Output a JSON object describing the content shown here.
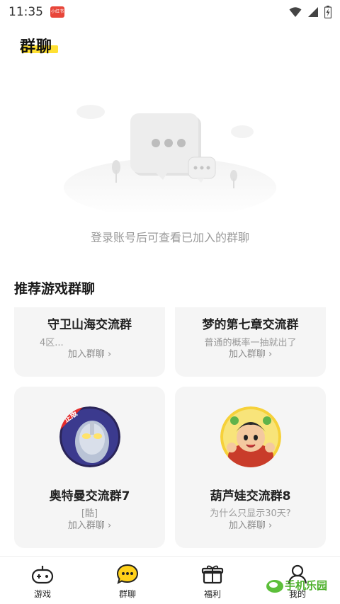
{
  "status_bar": {
    "time": "11:35",
    "badge": "小红书",
    "icons": [
      "wifi-icon",
      "signal-icon",
      "battery-charging-icon"
    ]
  },
  "header": {
    "title": "群聊"
  },
  "empty_state": {
    "message": "登录账号后可查看已加入的群聊"
  },
  "recommend": {
    "title": "推荐游戏群聊",
    "cards": [
      {
        "name": "守卫山海交流群",
        "desc": "4区...",
        "join": "加入群聊 ›"
      },
      {
        "name": "梦的第七章交流群",
        "desc": "普通的概率一抽就出了",
        "join": "加入群聊 ›"
      },
      {
        "name": "奥特曼交流群7",
        "desc": "[酷]",
        "join": "加入群聊 ›",
        "avatar_text": "正版"
      },
      {
        "name": "葫芦娃交流群8",
        "desc": "为什么只显示30天?",
        "join": "加入群聊 ›"
      }
    ]
  },
  "bottom_nav": {
    "items": [
      {
        "label": "游戏",
        "icon": "gamepad-icon"
      },
      {
        "label": "群聊",
        "icon": "chat-bubble-icon",
        "active": true
      },
      {
        "label": "福利",
        "icon": "gift-icon"
      },
      {
        "label": "我的",
        "icon": "user-icon"
      }
    ]
  },
  "watermark": {
    "text": "手机乐园"
  },
  "colors": {
    "accent": "#ffd11a",
    "card_bg": "#f5f5f5",
    "muted_text": "#9a9a9a"
  }
}
